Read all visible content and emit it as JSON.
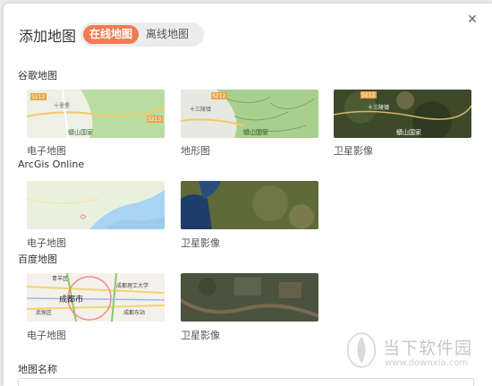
{
  "dialog": {
    "title": "添加地图",
    "close_icon": "close-icon",
    "tabs": [
      {
        "label": "在线地图",
        "active": true
      },
      {
        "label": "离线地图",
        "active": false
      }
    ],
    "accent_color": "#f37a53"
  },
  "sections": [
    {
      "title": "谷歌地图",
      "items": [
        {
          "label": "电子地图",
          "map_labels": [
            "S212",
            "S213",
            "十里堡",
            "蟒山国家"
          ]
        },
        {
          "label": "地形图",
          "map_labels": [
            "S212",
            "十三陵镇",
            "蟒山国家"
          ]
        },
        {
          "label": "卫星影像",
          "map_labels": [
            "S212",
            "十三陵镇",
            "蟒山国家"
          ]
        }
      ]
    },
    {
      "title": "ArcGis Online",
      "items": [
        {
          "label": "电子地图"
        },
        {
          "label": "卫星影像"
        }
      ]
    },
    {
      "title": "百度地图",
      "items": [
        {
          "label": "电子地图",
          "map_labels": [
            "青羊区",
            "成都市",
            "武侯区",
            "成都理工大学",
            "成都东站"
          ]
        },
        {
          "label": "卫星影像"
        }
      ]
    }
  ],
  "form": {
    "name_label": "地图名称"
  },
  "watermark": {
    "text": "当下软件园",
    "url": "www.downxia.com"
  }
}
